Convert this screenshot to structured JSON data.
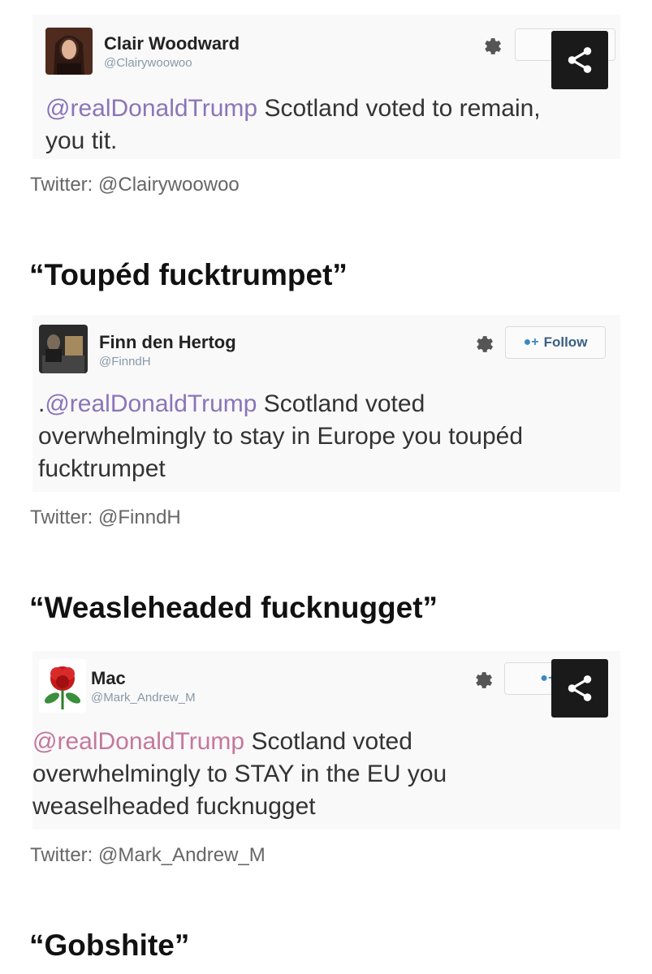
{
  "tweets": [
    {
      "name": "Clair Woodward",
      "handle": "@Clairywoowoo",
      "mention": "@realDonaldTrump",
      "text_line1": " Scotland voted to remain,",
      "text_line2": "you tit.",
      "follow_label": "",
      "caption": "Twitter: @Clairywoowoo"
    },
    {
      "name": "Finn den Hertog",
      "handle": "@FinndH",
      "prefix": ".",
      "mention": "@realDonaldTrump",
      "text_line1": " Scotland voted",
      "text_line2": "overwhelmingly to stay in Europe you toupéd",
      "text_line3": "fucktrumpet",
      "follow_label": "Follow",
      "caption": "Twitter: @FinndH"
    },
    {
      "name": "Mac",
      "handle": "@Mark_Andrew_M",
      "mention": "@realDonaldTrump",
      "text_line1": " Scotland voted",
      "text_line2": "overwhelmingly to STAY in the EU you",
      "text_line3": "weaselheaded fucknugget",
      "follow_label": "F",
      "caption": "Twitter: @Mark_Andrew_M"
    }
  ],
  "headings": [
    "“Toupéd fucktrumpet”",
    "“Weasleheaded fucknugget”",
    "“Gobshite”"
  ],
  "colors": {
    "mention": "#8a75b8",
    "share_bg": "#1a1a1a",
    "card_bg": "#f9f9fa"
  }
}
